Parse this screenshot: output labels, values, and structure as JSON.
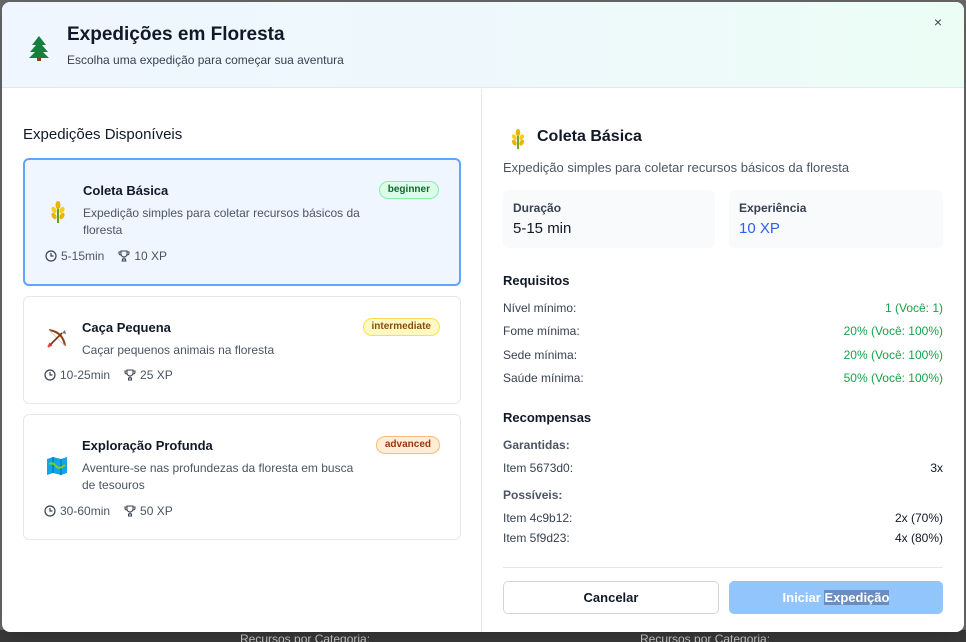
{
  "header": {
    "title": "Expedições em Floresta",
    "subtitle": "Escolha uma expedição para começar sua aventura",
    "close_label": "×"
  },
  "list": {
    "title": "Expedições Disponíveis",
    "cards": [
      {
        "icon": "wheat-icon",
        "title": "Coleta Básica",
        "description": "Expedição simples para coletar recursos básicos da floresta",
        "badge": "beginner",
        "duration": "5-15min",
        "xp": "10 XP",
        "selected": true
      },
      {
        "icon": "bow-arrow-icon",
        "title": "Caça Pequena",
        "description": "Caçar pequenos animais na floresta",
        "badge": "intermediate",
        "duration": "10-25min",
        "xp": "25 XP",
        "selected": false
      },
      {
        "icon": "map-icon",
        "title": "Exploração Profunda",
        "description": "Aventure-se nas profundezas da floresta em busca de tesouros",
        "badge": "advanced",
        "duration": "30-60min",
        "xp": "50 XP",
        "selected": false
      }
    ]
  },
  "detail": {
    "title": "Coleta Básica",
    "description": "Expedição simples para coletar recursos básicos da floresta",
    "duration_label": "Duração",
    "duration_value": "5-15 min",
    "xp_label": "Experiência",
    "xp_value": "10 XP",
    "requirements_title": "Requisitos",
    "requirements": [
      {
        "label": "Nível mínimo:",
        "value": "1 (Você: 1)"
      },
      {
        "label": "Fome mínima:",
        "value": "20% (Você: 100%)"
      },
      {
        "label": "Sede mínima:",
        "value": "20% (Você: 100%)"
      },
      {
        "label": "Saúde mínima:",
        "value": "50% (Você: 100%)"
      }
    ],
    "rewards_title": "Recompensas",
    "guaranteed_label": "Garantidas:",
    "guaranteed": [
      {
        "label": "Item 5673d0:",
        "value": "3x"
      }
    ],
    "possible_label": "Possíveis:",
    "possible": [
      {
        "label": "Item 4c9b12:",
        "value": "2x (70%)"
      },
      {
        "label": "Item 5f9d23:",
        "value": "4x (80%)"
      }
    ],
    "cancel_label": "Cancelar",
    "start_label_a": "Iniciar ",
    "start_label_b": "Expedição"
  },
  "background": {
    "left_text": "Recursos por Categoria:",
    "right_text": "Recursos por Categoria:"
  },
  "colors": {
    "accent_blue": "#2563eb",
    "success_green": "#16a34a",
    "selected_border": "#60a5fa",
    "start_button": "#93c5fd"
  }
}
